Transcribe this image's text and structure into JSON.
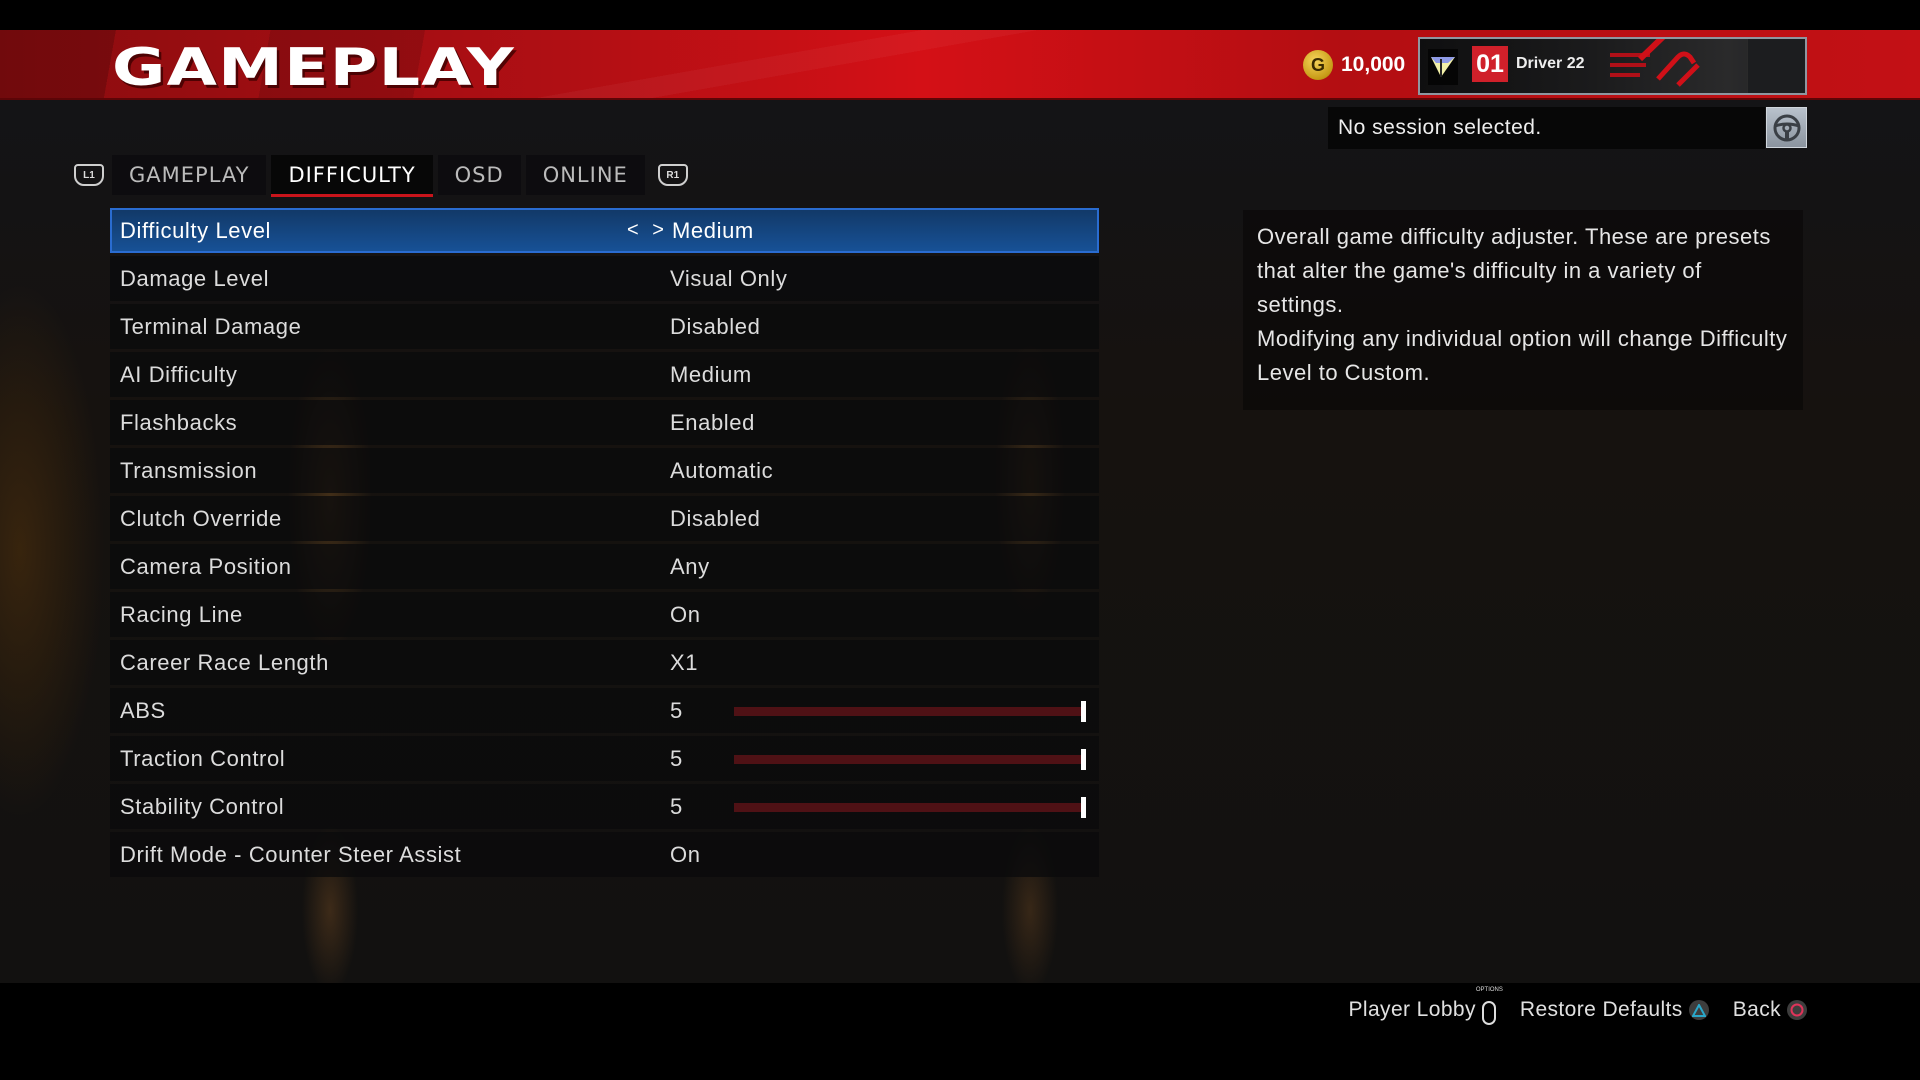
{
  "header": {
    "title": "GAMEPLAY",
    "currency_icon": "g-coin-icon",
    "currency_amount": "10,000",
    "driver": {
      "number": "01",
      "name": "Driver 22"
    }
  },
  "session": {
    "status": "No session selected.",
    "icon": "steering-wheel-icon"
  },
  "tabs": {
    "left_bumper": "L1",
    "right_bumper": "R1",
    "items": [
      {
        "label": "GAMEPLAY",
        "active": false
      },
      {
        "label": "DIFFICULTY",
        "active": true
      },
      {
        "label": "OSD",
        "active": false
      },
      {
        "label": "ONLINE",
        "active": false
      }
    ]
  },
  "settings": [
    {
      "label": "Difficulty Level",
      "value": "Medium",
      "selected": true,
      "arrows": "< >"
    },
    {
      "label": "Damage Level",
      "value": "Visual Only"
    },
    {
      "label": "Terminal Damage",
      "value": "Disabled"
    },
    {
      "label": "AI Difficulty",
      "value": "Medium"
    },
    {
      "label": "Flashbacks",
      "value": "Enabled"
    },
    {
      "label": "Transmission",
      "value": "Automatic"
    },
    {
      "label": "Clutch Override",
      "value": "Disabled"
    },
    {
      "label": "Camera Position",
      "value": "Any"
    },
    {
      "label": "Racing Line",
      "value": "On"
    },
    {
      "label": "Career Race Length",
      "value": "X1"
    },
    {
      "label": "ABS",
      "value": "5",
      "slider": 1.0
    },
    {
      "label": "Traction Control",
      "value": "5",
      "slider": 1.0
    },
    {
      "label": "Stability Control",
      "value": "5",
      "slider": 1.0
    },
    {
      "label": "Drift Mode - Counter Steer Assist",
      "value": "On"
    }
  ],
  "description": {
    "line1": "Overall game difficulty adjuster. These are presets that alter the game's difficulty in a variety of settings.",
    "line2": "Modifying any individual option will change Difficulty Level to Custom."
  },
  "footer": {
    "player_lobby": "Player Lobby",
    "options_caption": "OPTIONS",
    "restore_defaults": "Restore Defaults",
    "back": "Back"
  },
  "colors": {
    "accent_red": "#c8141b",
    "selected_blue": "#175196",
    "triangle": "#2aa7c9",
    "circle": "#e0345a"
  }
}
